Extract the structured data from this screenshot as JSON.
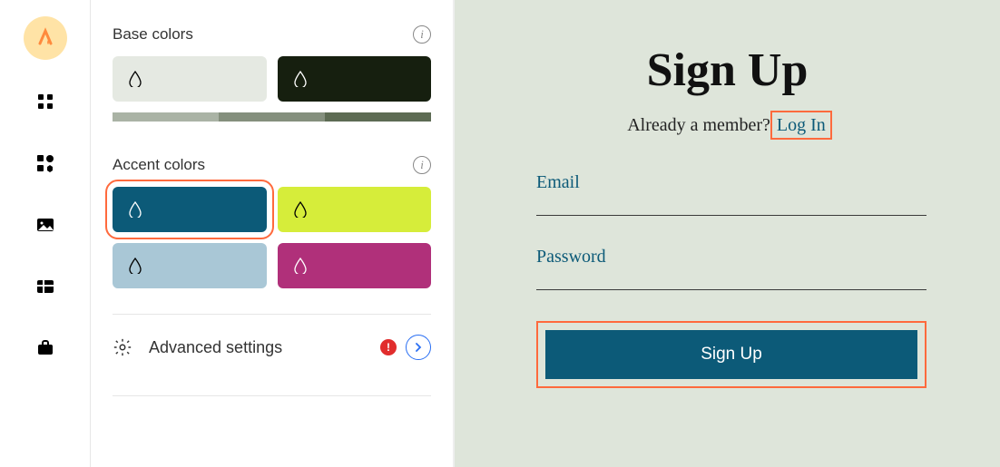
{
  "sidebar": {
    "items": [
      "logo",
      "apps",
      "plugins",
      "image",
      "table",
      "briefcase"
    ]
  },
  "panel": {
    "base_colors": {
      "label": "Base colors",
      "swatches": [
        "#e5e9e2",
        "#161f0f"
      ],
      "gradient": [
        "#aab3a5",
        "#848f7d",
        "#5d6b53"
      ]
    },
    "accent_colors": {
      "label": "Accent colors",
      "swatches": [
        "#0c5a78",
        "#d6ed3a",
        "#a9c7d6",
        "#b0307a"
      ],
      "selected_index": 0
    },
    "advanced": {
      "label": "Advanced settings",
      "alert": "!"
    }
  },
  "preview": {
    "title": "Sign Up",
    "member_prefix": "Already a member?",
    "login_link": "Log In",
    "email_label": "Email",
    "password_label": "Password",
    "button_label": "Sign Up"
  }
}
